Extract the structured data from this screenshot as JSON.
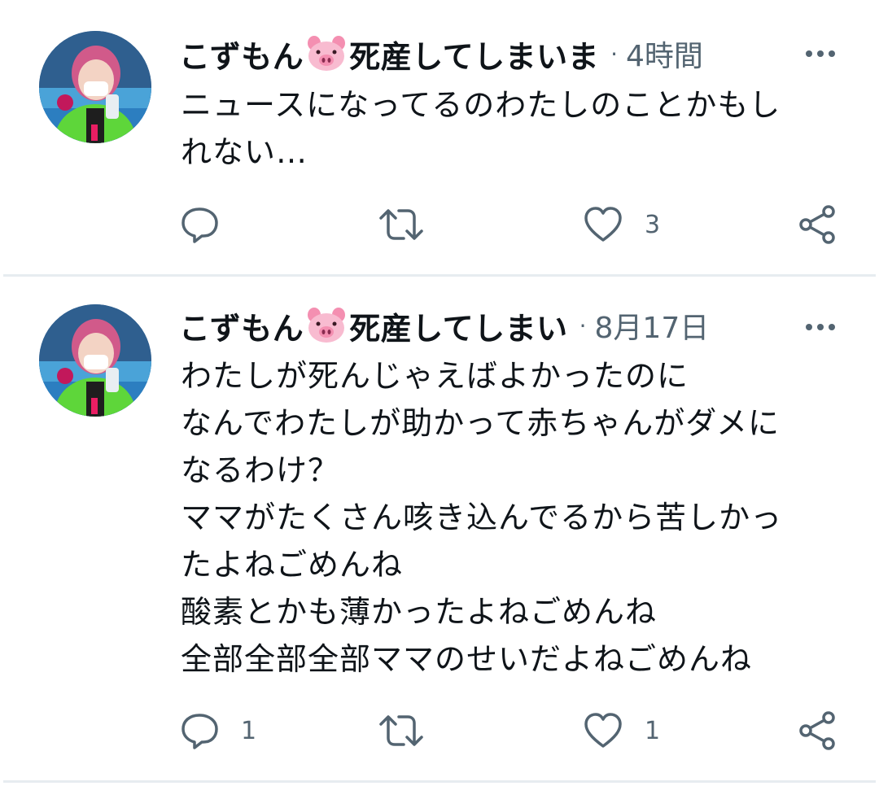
{
  "tweets": [
    {
      "display_name_prefix": "こずもん",
      "display_name_suffix": "死産してしまいま",
      "avatar_icon": "profile-photo",
      "separator": "·",
      "time": "4時間",
      "text": "ニュースになってるのわたしのことかもし\nれない…",
      "reply_count": "",
      "retweet_count": "",
      "like_count": "3"
    },
    {
      "display_name_prefix": "こずもん",
      "display_name_suffix": "死産してしまい",
      "avatar_icon": "profile-photo",
      "separator": "·",
      "time": "8月17日",
      "text": "わたしが死んじゃえばよかったのに\nなんでわたしが助かって赤ちゃんがダメに\nなるわけ？\nママがたくさん咳き込んでるから苦しかっ\nたよねごめんね\n酸素とかも薄かったよねごめんね\n全部全部全部ママのせいだよねごめんね",
      "reply_count": "1",
      "retweet_count": "",
      "like_count": "1"
    }
  ],
  "icons": {
    "pig": "pig-face-emoji",
    "more": "more-dots-icon",
    "reply": "reply-icon",
    "retweet": "retweet-icon",
    "like": "heart-icon",
    "share": "share-icon"
  },
  "colors": {
    "text_primary": "#0f1419",
    "text_secondary": "#536471",
    "divider": "#e7ecf0",
    "pig_pink": "#f7a8c0"
  }
}
